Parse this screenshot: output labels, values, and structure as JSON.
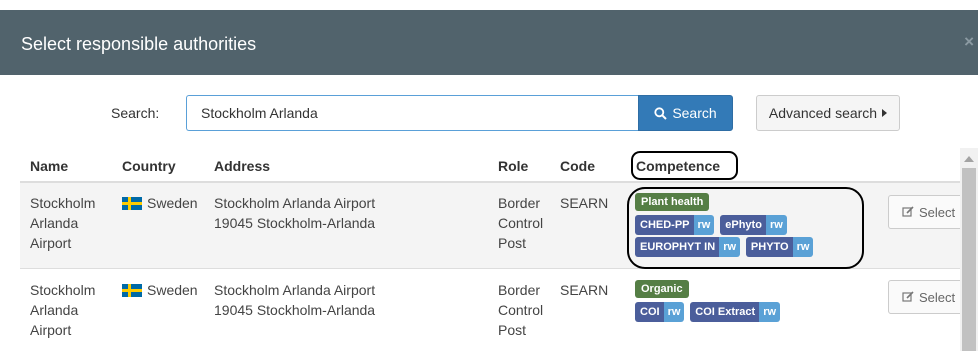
{
  "dialog": {
    "title": "Select responsible authorities",
    "close_glyph": "×"
  },
  "search": {
    "label": "Search:",
    "value": "Stockholm Arlanda",
    "button_label": "Search",
    "advanced_label": "Advanced search"
  },
  "table": {
    "headers": {
      "name": "Name",
      "country": "Country",
      "address": "Address",
      "role": "Role",
      "code": "Code",
      "competence": "Competence"
    },
    "rows": [
      {
        "name": "Stockholm Arlanda Airport",
        "country": "Sweden",
        "address_line1": "Stockholm Arlanda Airport",
        "address_line2": "19045 Stockholm-Arlanda",
        "role": "Border Control Post",
        "code": "SEARN",
        "category": "Plant health",
        "tags": [
          {
            "name": "CHED-PP",
            "access": "rw"
          },
          {
            "name": "ePhyto",
            "access": "rw"
          },
          {
            "name": "EUROPHYT IN",
            "access": "rw"
          },
          {
            "name": "PHYTO",
            "access": "rw"
          }
        ],
        "select_label": "Select"
      },
      {
        "name": "Stockholm Arlanda Airport",
        "country": "Sweden",
        "address_line1": "Stockholm Arlanda Airport",
        "address_line2": "19045 Stockholm-Arlanda",
        "role": "Border Control Post",
        "code": "SEARN",
        "category": "Organic",
        "tags": [
          {
            "name": "COI",
            "access": "rw"
          },
          {
            "name": "COI Extract",
            "access": "rw"
          }
        ],
        "select_label": "Select"
      }
    ]
  },
  "colors": {
    "header_bg": "#51636c",
    "primary": "#337ab7",
    "category_badge": "#557e45",
    "tag": "#4b5e9b",
    "tag_access": "#5aa1d6",
    "annotation": "#000000"
  }
}
